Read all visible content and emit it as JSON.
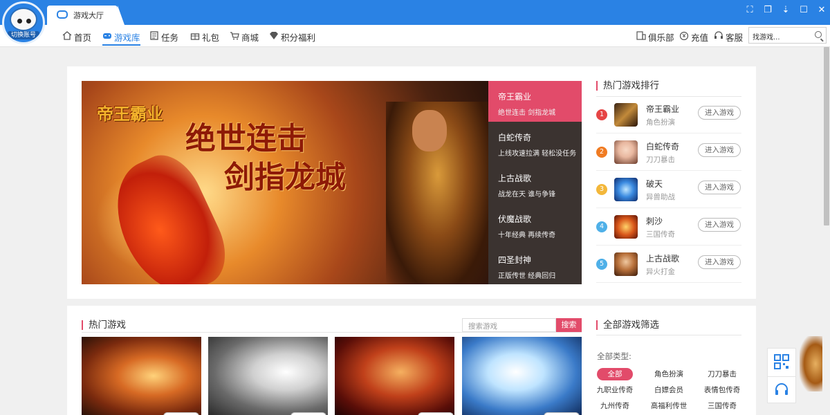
{
  "app": {
    "tab_label": "游戏大厅",
    "avatar_label": "切换账号"
  },
  "nav": {
    "items": [
      {
        "label": "首页",
        "icon": "home-icon"
      },
      {
        "label": "游戏库",
        "icon": "gamepad-icon",
        "active": true
      },
      {
        "label": "任务",
        "icon": "task-icon"
      },
      {
        "label": "礼包",
        "icon": "gift-icon"
      },
      {
        "label": "商城",
        "icon": "cart-icon"
      },
      {
        "label": "积分福利",
        "icon": "diamond-icon"
      }
    ],
    "right": [
      {
        "label": "俱乐部",
        "icon": "club-icon"
      },
      {
        "label": "充值",
        "icon": "recharge-icon"
      },
      {
        "label": "客服",
        "icon": "service-icon"
      }
    ],
    "search_placeholder": "找游戏..."
  },
  "banner": {
    "logo_text": "帝王霸业",
    "slogan_line1": "绝世连击",
    "slogan_line2": "剑指龙城",
    "list": [
      {
        "title": "帝王霸业",
        "subtitle": "绝世连击 剑指龙城",
        "active": true
      },
      {
        "title": "白蛇传奇",
        "subtitle": "上线攻速拉满 轻松没任务"
      },
      {
        "title": "上古战歌",
        "subtitle": "战龙在天 谁与争锋"
      },
      {
        "title": "伏魔战歌",
        "subtitle": "十年经典 再续传奇"
      },
      {
        "title": "四圣封神",
        "subtitle": "正版传世 经典回归"
      }
    ]
  },
  "ranking": {
    "title": "热门游戏排行",
    "button_label": "进入游戏",
    "items": [
      {
        "rank": "1",
        "name": "帝王霸业",
        "genre": "角色扮演",
        "color": "#e64545"
      },
      {
        "rank": "2",
        "name": "白蛇传奇",
        "genre": "刀刀暴击",
        "color": "#f07b22"
      },
      {
        "rank": "3",
        "name": "破天",
        "genre": "异兽助战",
        "color": "#f3b73a"
      },
      {
        "rank": "4",
        "name": "刺沙",
        "genre": "三国传奇",
        "color": "#4fb0e8"
      },
      {
        "rank": "5",
        "name": "上古战歌",
        "genre": "异火打金",
        "color": "#4fb0e8"
      }
    ]
  },
  "hot_games": {
    "title": "热门游戏",
    "search_placeholder": "搜索游戏",
    "search_button": "搜索"
  },
  "filter": {
    "title": "全部游戏筛选",
    "label": "全部类型:",
    "options": [
      "全部",
      "角色扮演",
      "刀刀暴击",
      "九职业传奇",
      "白嫖会员",
      "表情包传奇",
      "九州传奇",
      "高福利传世",
      "三国传奇"
    ]
  },
  "colors": {
    "brand_blue": "#2a82e4",
    "accent_pink": "#e24b6a"
  }
}
